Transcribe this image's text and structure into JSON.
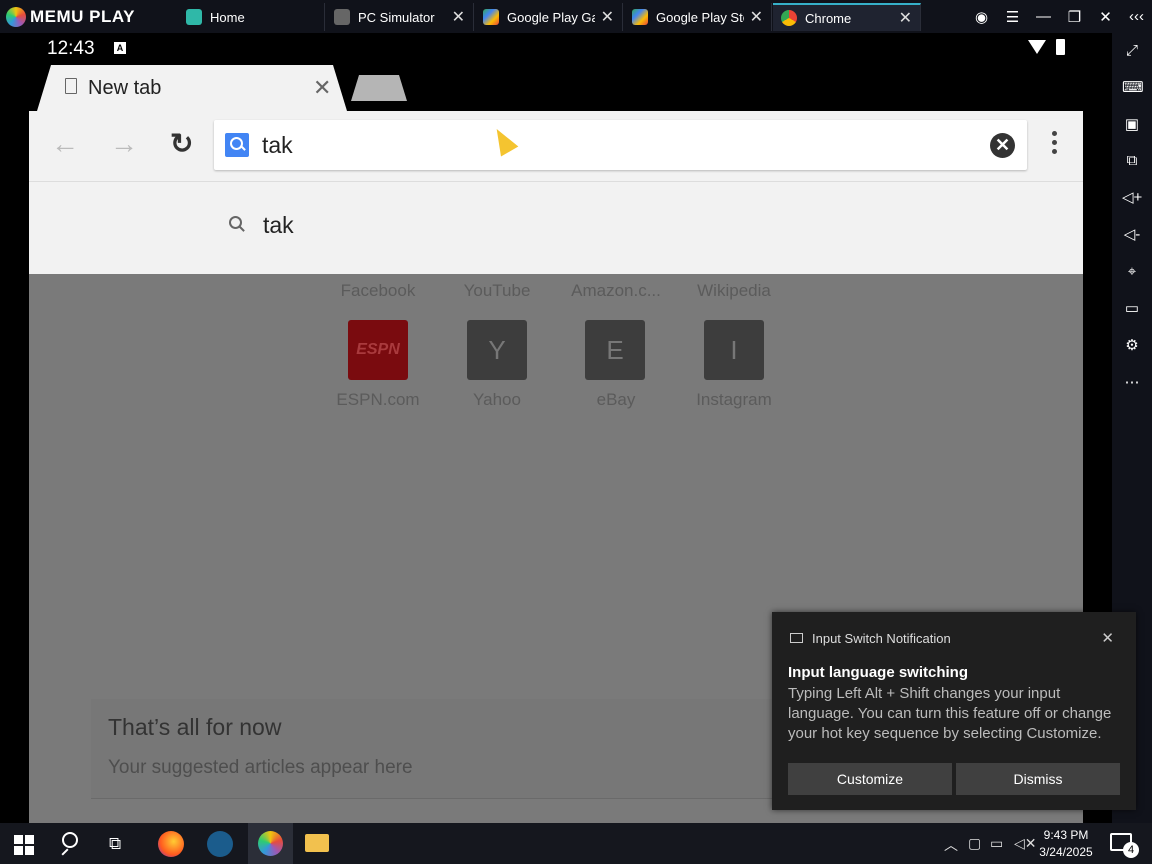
{
  "memu": {
    "brand": "MEMU PLAY",
    "tabs": [
      {
        "label": "Home",
        "closable": false
      },
      {
        "label": "PC Simulator",
        "closable": true
      },
      {
        "label": "Google Play Ga",
        "closable": true
      },
      {
        "label": "Google Play Sto",
        "closable": true
      },
      {
        "label": "Chrome",
        "closable": true,
        "active": true
      }
    ],
    "close_glyph": "✕",
    "accent": "#36b0c9"
  },
  "android": {
    "time": "12:43",
    "indicator": "A"
  },
  "chrome": {
    "tab_title": "New tab",
    "tab_close": "✕",
    "query": "tak",
    "suggestion": "tak",
    "back_glyph": "←",
    "forward_glyph": "→",
    "reload_glyph": "↻",
    "clear_glyph": "✕",
    "site_labels_top": [
      "Facebook",
      "YouTube",
      "Amazon.c...",
      "Wikipedia"
    ],
    "tiles": [
      {
        "letter": "ESPN",
        "label": "ESPN.com"
      },
      {
        "letter": "Y",
        "label": "Yahoo"
      },
      {
        "letter": "E",
        "label": "eBay"
      },
      {
        "letter": "I",
        "label": "Instagram"
      }
    ],
    "articles_heading": "That’s all for now",
    "articles_sub": "Your suggested articles appear here"
  },
  "toast": {
    "header": "Input Switch Notification",
    "title": "Input language switching",
    "body": "Typing Left Alt + Shift changes your input language. You can turn this feature off or change your hot key sequence by selecting Customize.",
    "customize": "Customize",
    "dismiss": "Dismiss",
    "close": "✕"
  },
  "taskbar": {
    "time": "9:43 PM",
    "date": "3/24/2025",
    "notifications": "4"
  }
}
